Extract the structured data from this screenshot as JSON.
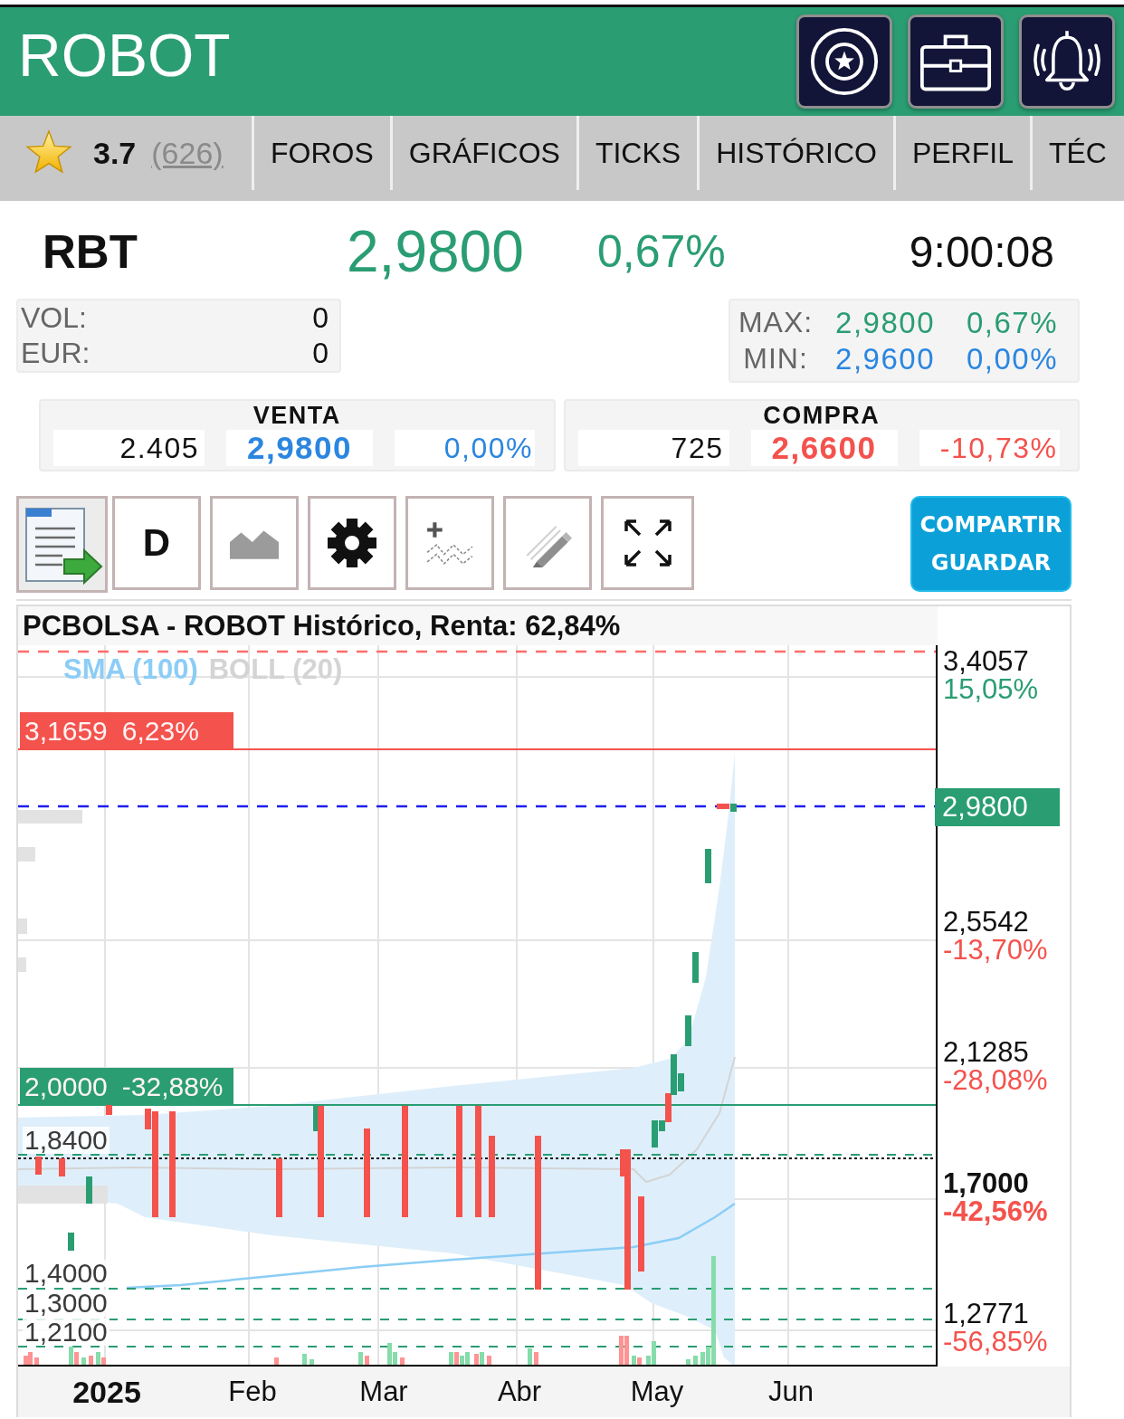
{
  "header": {
    "title": "ROBOT"
  },
  "rating": {
    "value": "3.7",
    "count": "(626)"
  },
  "tabs": [
    {
      "label": "FOROS"
    },
    {
      "label": "GRÁFICOS"
    },
    {
      "label": "TICKS"
    },
    {
      "label": "HISTÓRICO"
    },
    {
      "label": "PERFIL"
    },
    {
      "label": "TÉC"
    }
  ],
  "quote": {
    "symbol": "RBT",
    "price": "2,9800",
    "change": "0,67%",
    "time": "9:00:08"
  },
  "volume": [
    {
      "label": "VOL:",
      "value": "0"
    },
    {
      "label": "EUR:",
      "value": "0"
    }
  ],
  "range": [
    {
      "label": "MAX:",
      "price": "2,9800",
      "change": "0,67%",
      "color": "#2a9d73"
    },
    {
      "label": "MIN:",
      "price": "2,9600",
      "change": "0,00%",
      "color": "#2b86e0"
    }
  ],
  "order_book": [
    {
      "side": "VENTA",
      "quantity": "2.405",
      "price": "2,9800",
      "change": "0,00%",
      "color": "#2b86e0"
    },
    {
      "side": "COMPRA",
      "quantity": "725",
      "price": "2,6600",
      "change": "-10,73%",
      "color": "#f4524d"
    }
  ],
  "toolbar": {
    "period": "D",
    "share_button": [
      "COMPARTIR",
      "GUARDAR"
    ]
  },
  "chart": {
    "title": "PCBOLSA - ROBOT Histórico, Renta: 62,84%",
    "legend": [
      {
        "label": "SMA (100)",
        "color": "#8ccdf6"
      },
      {
        "label": "BOLL (20)",
        "color": "#d4d4d4"
      }
    ],
    "price_tags": [
      {
        "price": "3,1659",
        "change": "6,23%",
        "color": "#f4524d"
      },
      {
        "price": "2,0000",
        "change": "-32,88%",
        "color": "#2a9d73"
      }
    ],
    "level_labels": [
      "1,8400",
      "1,4000",
      "1,3000",
      "1,2100"
    ],
    "last_price": "2,9800",
    "axis_labels": [
      {
        "price": "3,4057",
        "change": "15,05%",
        "color": "#2a9d73",
        "emphasized": false
      },
      {
        "price": "2,5542",
        "change": "-13,70%",
        "color": "#f4524d",
        "emphasized": false
      },
      {
        "price": "2,1285",
        "change": "-28,08%",
        "color": "#f4524d",
        "emphasized": false
      },
      {
        "price": "1,7000",
        "change": "-42,56%",
        "color": "#f4524d",
        "emphasized": true
      },
      {
        "price": "1,2771",
        "change": "-56,85%",
        "color": "#f4524d",
        "emphasized": false
      }
    ],
    "months": [
      {
        "label": "2025",
        "kind": "year"
      },
      {
        "label": "Feb",
        "kind": "month"
      },
      {
        "label": "Mar",
        "kind": "month"
      },
      {
        "label": "Abr",
        "kind": "month"
      },
      {
        "label": "May",
        "kind": "month"
      },
      {
        "label": "Jun",
        "kind": "month"
      }
    ]
  }
}
